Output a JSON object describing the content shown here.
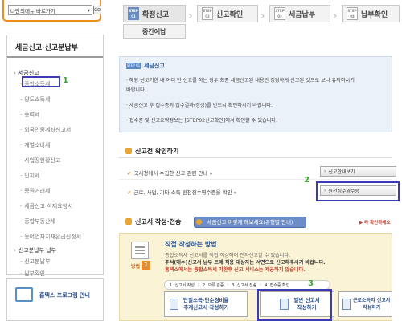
{
  "quick_select": {
    "value": "나만의메뉴 바로가기",
    "go_label": "GO"
  },
  "side_menu": {
    "title": "세금신고·신고분납부",
    "items": [
      {
        "label": "세금신고"
      },
      {
        "label": "종합소득세"
      },
      {
        "label": "양도소득세"
      },
      {
        "label": "증여세"
      },
      {
        "label": "외국인종계좌신고서"
      },
      {
        "label": "개별소비세"
      },
      {
        "label": "사업장현황신고"
      },
      {
        "label": "인지세"
      },
      {
        "label": "증권거래세"
      },
      {
        "label": "세금신고 석제요청서"
      },
      {
        "label": "종합부동산세"
      },
      {
        "label": "농어업자지재환급신청서"
      },
      {
        "label": "신고분납부 납부"
      },
      {
        "label": "신고분납부"
      },
      {
        "label": "납부확인"
      }
    ]
  },
  "hometax_banner": {
    "label": "홈택스 프로그램 안내"
  },
  "steps": {
    "step1": {
      "tag": "STEP 01",
      "label": "확정신고"
    },
    "step1b": {
      "label": "중간예납"
    },
    "step2": {
      "tag": "STEP 02",
      "label": "신고확인"
    },
    "step3": {
      "tag": "STEP 03",
      "label": "세금납부"
    },
    "step4": {
      "tag": "STEP 04",
      "label": "납부확인"
    }
  },
  "notice": {
    "badge": "STEP 01",
    "title": "세금신고",
    "lines": [
      "· 해당 신고기한 내 여러 번 신고를 하는 경우 최종 세금신고된 내용만 정당하게 신고된 것으로 보니 유의하시기",
      "  바랍니다.",
      "· 세금신고 후 접수증의 접수결과(정상)를 반드시 확인하시기 바랍니다.",
      "· 접수증 및 신고요약정보는 [STEP02신고확인]에서 확인할 수 있습니다."
    ]
  },
  "pre_check": {
    "title": "신고전 확인하기",
    "lines": [
      "국세청에서 수집한 신고 관련 안내 »",
      "근로, 사업, 기타 소득 원천징수영수증을 확인 »"
    ],
    "buttons": [
      "신고안내보기",
      "원천징수영수증"
    ]
  },
  "filing": {
    "title": "신고서 작성·전송",
    "simulate_label": "세금신고 이렇게 해보세요(유형별 안내)",
    "other_link": "▶ 타 확인하세요"
  },
  "direct": {
    "title": "직접 작성하는 방법",
    "method_label": "방법",
    "method_num": "1",
    "lines": [
      "종합소득세 신고서를 직접 작성하여 전자신고할 수 있습니다.",
      "주석(매수)신고서 납부 트레 적용 대상자는 서면으로 신고해주시기 바랍니다.",
      "홈택스에서는 종합소득세 기한후 신고 서비스는 제공하지 않습니다."
    ],
    "flow": [
      "1. 신고서 작성",
      "2. 오류 검증",
      "3. 신고서 전송",
      "4. 접수증 확인"
    ],
    "btn_a": [
      "단일소득-단순경비율",
      "추계신고서 작성하기"
    ],
    "btn_b": [
      "일반 신고서",
      "작성하기"
    ],
    "btn_c": [
      "근로소득자 신고서",
      "작성하기"
    ]
  },
  "annotations": {
    "n1": "1",
    "n2": "2",
    "n3": "3"
  }
}
